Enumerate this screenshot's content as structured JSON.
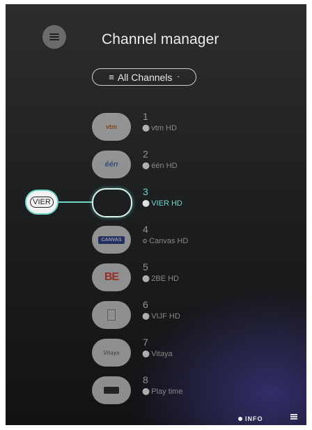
{
  "header": {
    "title": "Channel manager"
  },
  "filter": {
    "label": "All Channels",
    "caret": "-"
  },
  "channels": [
    {
      "number": "1",
      "name": "vtm HD",
      "lock": "key-icon"
    },
    {
      "number": "2",
      "name": "één HD",
      "lock": "key-icon"
    },
    {
      "number": "3",
      "name": "VIER HD",
      "lock": "key-icon",
      "selected": true
    },
    {
      "number": "4",
      "name": "Canvas HD",
      "lock": "gear-icon"
    },
    {
      "number": "5",
      "name": "2BE HD",
      "lock": "key-icon"
    },
    {
      "number": "6",
      "name": "VIJF HD",
      "lock": "key-icon"
    },
    {
      "number": "7",
      "name": "Vitaya",
      "lock": "key-icon"
    },
    {
      "number": "8",
      "name": "Play time",
      "lock": "key-icon"
    }
  ],
  "logos": {
    "c1": "vtm",
    "c2": "één",
    "c3": "VIER",
    "c4": "CANVAS",
    "c5": "BE",
    "c7": "Vitaya"
  },
  "footer": {
    "info_label": "INFO"
  },
  "colors": {
    "accent": "#6fd7c6",
    "background": "#1f2123"
  }
}
